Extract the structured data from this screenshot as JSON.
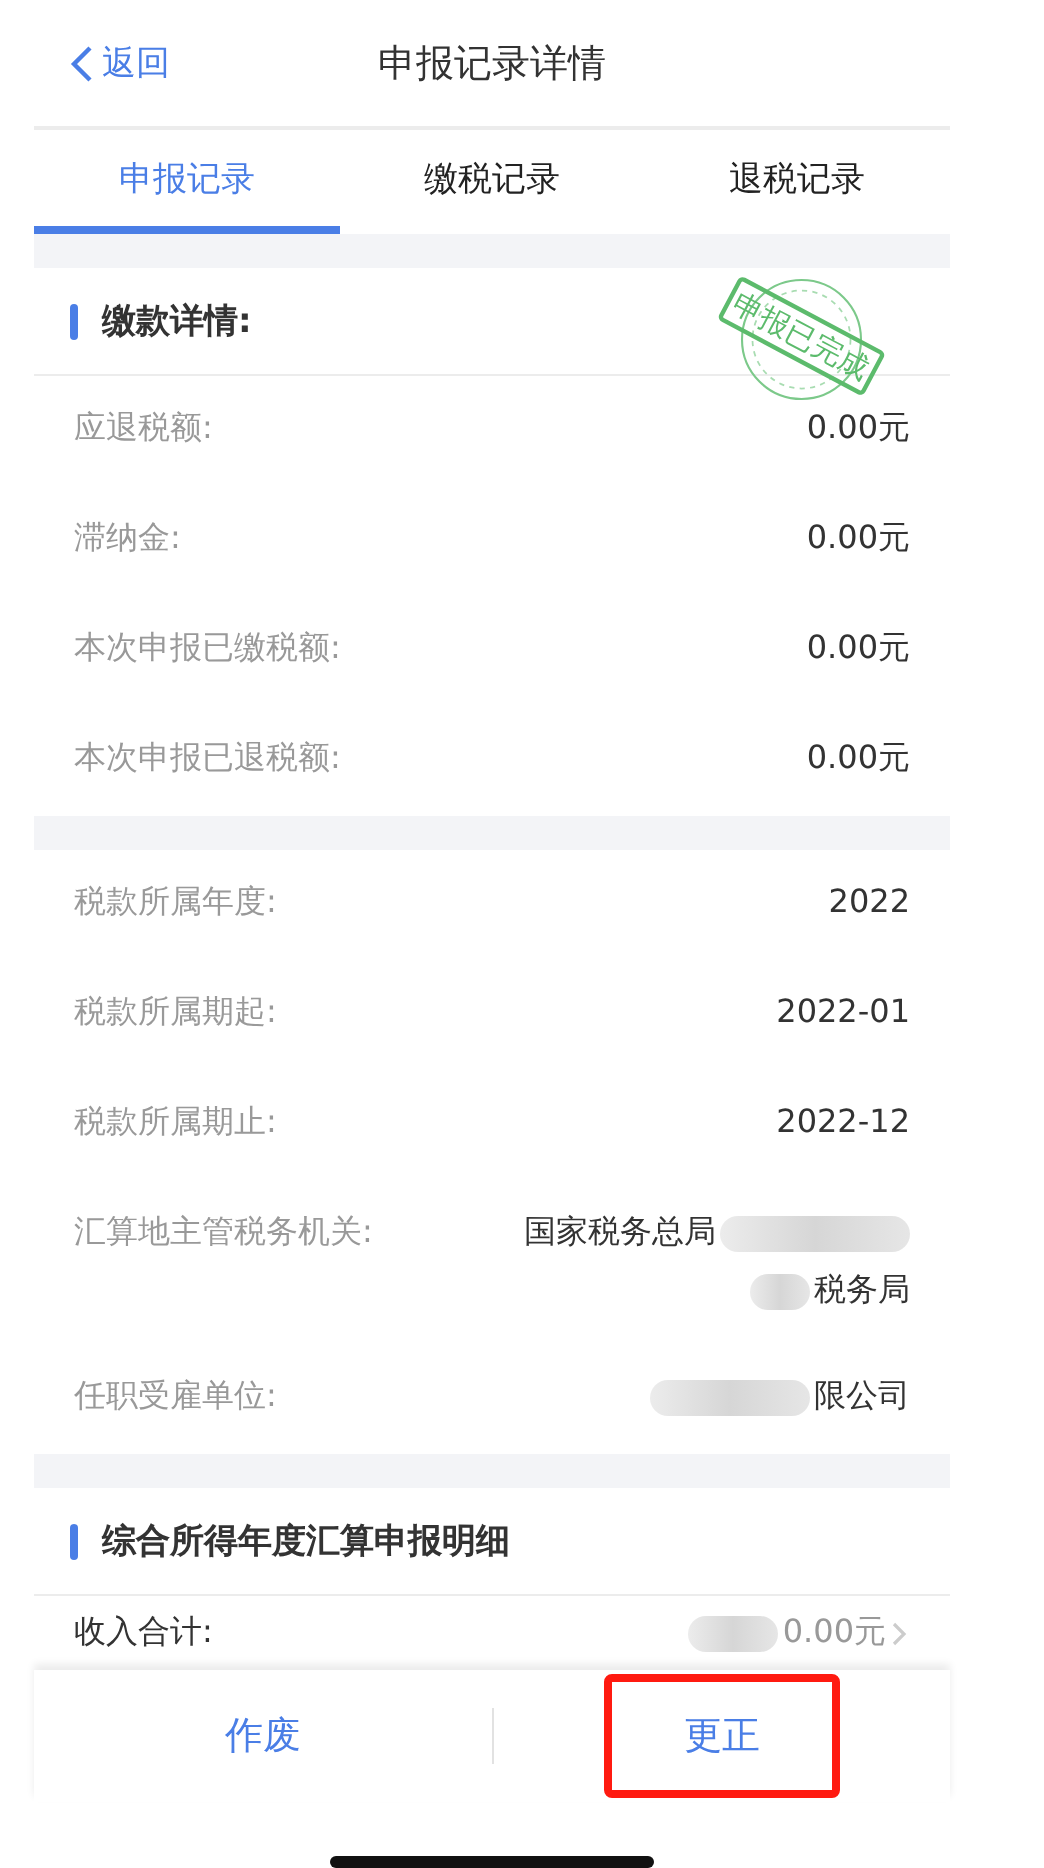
{
  "nav": {
    "back": "返回",
    "title": "申报记录详情"
  },
  "tabs": [
    {
      "label": "申报记录",
      "selected": true
    },
    {
      "label": "缴税记录",
      "selected": false
    },
    {
      "label": "退税记录",
      "selected": false
    }
  ],
  "stamp": "申报已完成",
  "sections": [
    {
      "kind": "header",
      "title": "缴款详情:"
    },
    {
      "kind": "rows",
      "rows": [
        {
          "label": "应退税额:",
          "lines": [
            "0.00元"
          ]
        },
        {
          "label": "滞纳金:",
          "lines": [
            "0.00元"
          ]
        },
        {
          "label": "本次申报已缴税额:",
          "lines": [
            "0.00元"
          ]
        },
        {
          "label": "本次申报已退税额:",
          "lines": [
            "0.00元"
          ]
        }
      ]
    },
    {
      "kind": "rows",
      "rows": [
        {
          "label": "税款所属年度:",
          "lines": [
            "2022"
          ]
        },
        {
          "label": "税款所属期起:",
          "lines": [
            "2022-01"
          ]
        },
        {
          "label": "税款所属期止:",
          "lines": [
            "2022-12"
          ]
        },
        {
          "label": "汇算地主管税务机关:",
          "lines": [
            "国家税务总局",
            "税务局"
          ],
          "blurred": true
        },
        {
          "label": "任职受雇单位:",
          "lines": [
            "限公司"
          ],
          "blurred": true
        }
      ]
    },
    {
      "kind": "header",
      "title": "综合所得年度汇算申报明细"
    },
    {
      "kind": "link",
      "label": "收入合计:",
      "value": "0.00元",
      "blurred": true
    }
  ],
  "actions": [
    {
      "label": "作废",
      "highlighted": false
    },
    {
      "label": "更正",
      "highlighted": true
    }
  ]
}
